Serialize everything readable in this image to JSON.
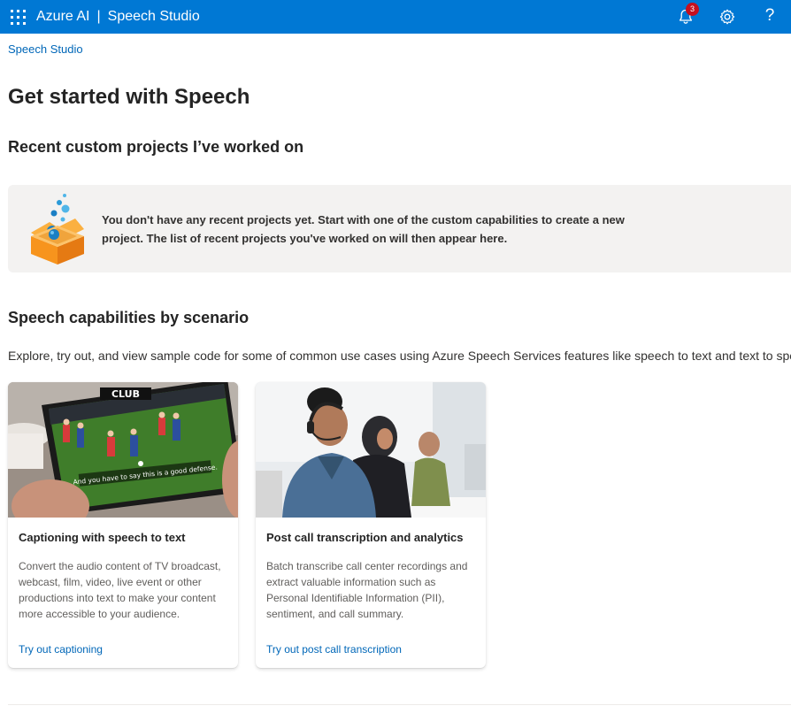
{
  "topbar": {
    "brand": "Azure AI",
    "separator": "|",
    "product": "Speech Studio",
    "notification_count": "3",
    "help_label": "?"
  },
  "breadcrumb": {
    "label": "Speech Studio"
  },
  "page_title": "Get started with Speech",
  "recent": {
    "heading": "Recent custom projects I’ve worked on",
    "empty_message": "You don't have any recent projects yet. Start with one of the custom capabilities to create a new project. The list of recent projects you've worked on will then appear here."
  },
  "capabilities": {
    "heading": "Speech capabilities by scenario",
    "description": "Explore, try out, and view sample code for some of common use cases using Azure Speech Services features like speech to text and text to speech.",
    "cards": [
      {
        "title": "Captioning with speech to text",
        "body": "Convert the audio content of TV broadcast, webcast, film, video, live event or other productions into text to make your content more accessible to your audience.",
        "link": "Try out captioning",
        "image_caption": "And you have to say this is a good defense.",
        "image_sign": "CLUB"
      },
      {
        "title": "Post call transcription and analytics",
        "body": "Batch transcribe call center recordings and extract valuable information such as Personal Identifiable Information (PII), sentiment, and call summary.",
        "link": "Try out post call transcription"
      }
    ]
  },
  "colors": {
    "topbar": "#0078d4",
    "link": "#0067b8",
    "badge": "#c50f1f",
    "empty_bg": "#f3f2f1",
    "illustration_orange": "#f7941d"
  },
  "icons": [
    "app-launcher-icon",
    "bell-icon",
    "gear-icon",
    "help-icon",
    "box-illustration"
  ]
}
